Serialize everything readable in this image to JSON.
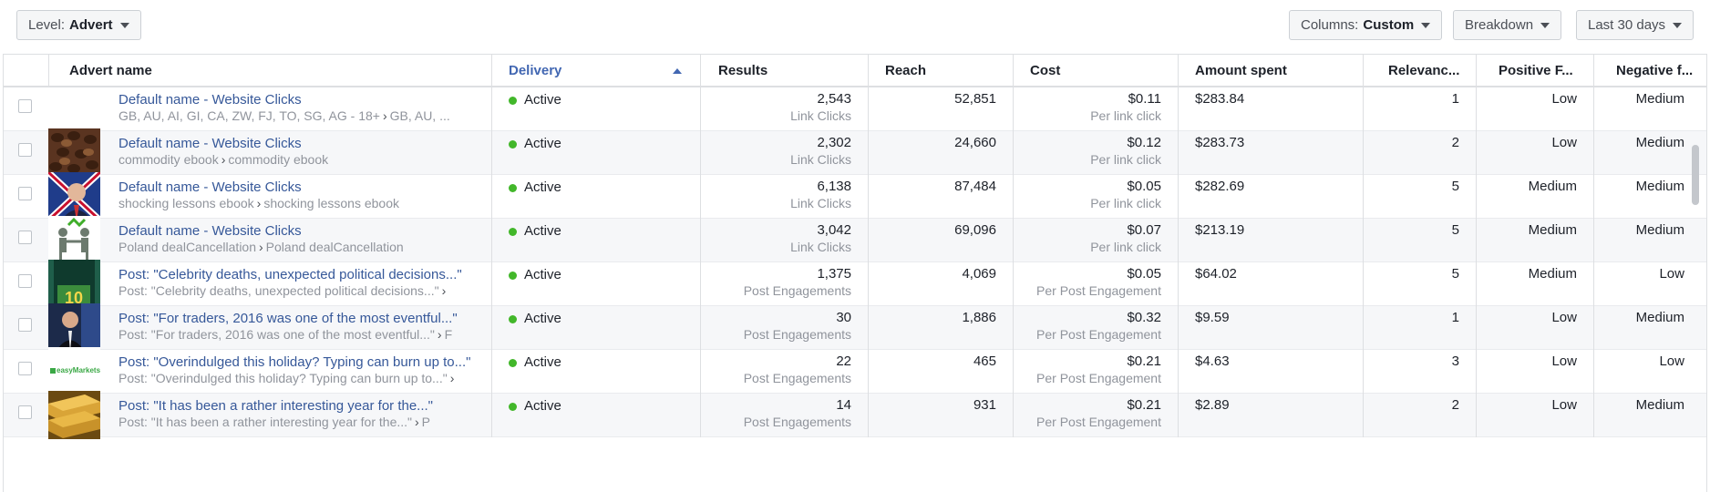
{
  "toolbar": {
    "level_prefix": "Level:",
    "level_value": "Advert",
    "columns_prefix": "Columns:",
    "columns_value": "Custom",
    "breakdown_label": "Breakdown",
    "date_range_label": "Last 30 days"
  },
  "table": {
    "headers": {
      "advert_name": "Advert name",
      "delivery": "Delivery",
      "results": "Results",
      "reach": "Reach",
      "cost": "Cost",
      "amount_spent": "Amount spent",
      "relevance": "Relevanc...",
      "positive": "Positive F...",
      "negative": "Negative f..."
    },
    "rows": [
      {
        "name": "Default name - Website Clicks",
        "sub_a": "GB, AU, AI, GI, CA, ZW, FJ, TO, SG, AG - 18+",
        "sub_b": "GB, AU, ...",
        "status": "Active",
        "results": "2,543",
        "results_type": "Link Clicks",
        "reach": "52,851",
        "cost": "$0.11",
        "cost_type": "Per link click",
        "spent": "$283.84",
        "relevance": "1",
        "positive": "Low",
        "negative": "Medium",
        "thumb": "none"
      },
      {
        "name": "Default name - Website Clicks",
        "sub_a": "commodity ebook",
        "sub_b": "commodity ebook",
        "status": "Active",
        "results": "2,302",
        "results_type": "Link Clicks",
        "reach": "24,660",
        "cost": "$0.12",
        "cost_type": "Per link click",
        "spent": "$283.73",
        "relevance": "2",
        "positive": "Low",
        "negative": "Medium",
        "thumb": "coffee-beans"
      },
      {
        "name": "Default name - Website Clicks",
        "sub_a": "shocking lessons ebook",
        "sub_b": "shocking lessons ebook",
        "status": "Active",
        "results": "6,138",
        "results_type": "Link Clicks",
        "reach": "87,484",
        "cost": "$0.05",
        "cost_type": "Per link click",
        "spent": "$282.69",
        "relevance": "5",
        "positive": "Medium",
        "negative": "Medium",
        "thumb": "politician-flag"
      },
      {
        "name": "Default name - Website Clicks",
        "sub_a": "Poland dealCancellation",
        "sub_b": "Poland dealCancellation",
        "status": "Active",
        "results": "3,042",
        "results_type": "Link Clicks",
        "reach": "69,096",
        "cost": "$0.07",
        "cost_type": "Per link click",
        "spent": "$213.19",
        "relevance": "5",
        "positive": "Medium",
        "negative": "Medium",
        "thumb": "handshake-figures"
      },
      {
        "name": "Post: \"Celebrity deaths, unexpected political decisions...\"",
        "sub_a": "Post: \"Celebrity deaths, unexpected political decisions...\"",
        "sub_b": "",
        "status": "Active",
        "results": "1,375",
        "results_type": "Post Engagements",
        "reach": "4,069",
        "cost": "$0.05",
        "cost_type": "Per Post Engagement",
        "spent": "$64.02",
        "relevance": "5",
        "positive": "Medium",
        "negative": "Low",
        "thumb": "number-ten"
      },
      {
        "name": "Post: \"For traders, 2016 was one of the most eventful...\"",
        "sub_a": "Post: \"For traders, 2016 was one of the most eventful...\"",
        "sub_b": "F",
        "status": "Active",
        "results": "30",
        "results_type": "Post Engagements",
        "reach": "1,886",
        "cost": "$0.32",
        "cost_type": "Per Post Engagement",
        "spent": "$9.59",
        "relevance": "1",
        "positive": "Low",
        "negative": "Medium",
        "thumb": "man-speaking"
      },
      {
        "name": "Post: \"Overindulged this holiday? Typing can burn up to...\"",
        "sub_a": "Post: \"Overindulged this holiday? Typing can burn up to...\"",
        "sub_b": "",
        "status": "Active",
        "results": "22",
        "results_type": "Post Engagements",
        "reach": "465",
        "cost": "$0.21",
        "cost_type": "Per Post Engagement",
        "spent": "$4.63",
        "relevance": "3",
        "positive": "Low",
        "negative": "Low",
        "thumb": "easymarkets-logo",
        "thumb_text": "easyMarkets"
      },
      {
        "name": "Post: \"It has been a rather interesting year for the...\"",
        "sub_a": "Post: \"It has been a rather interesting year for the...\"",
        "sub_b": "P",
        "status": "Active",
        "results": "14",
        "results_type": "Post Engagements",
        "reach": "931",
        "cost": "$0.21",
        "cost_type": "Per Post Engagement",
        "spent": "$2.89",
        "relevance": "2",
        "positive": "Low",
        "negative": "Medium",
        "thumb": "gold-bars"
      }
    ]
  },
  "colors": {
    "link": "#365899",
    "active_dot": "#42b72a",
    "sorted_header": "#4267b2"
  }
}
